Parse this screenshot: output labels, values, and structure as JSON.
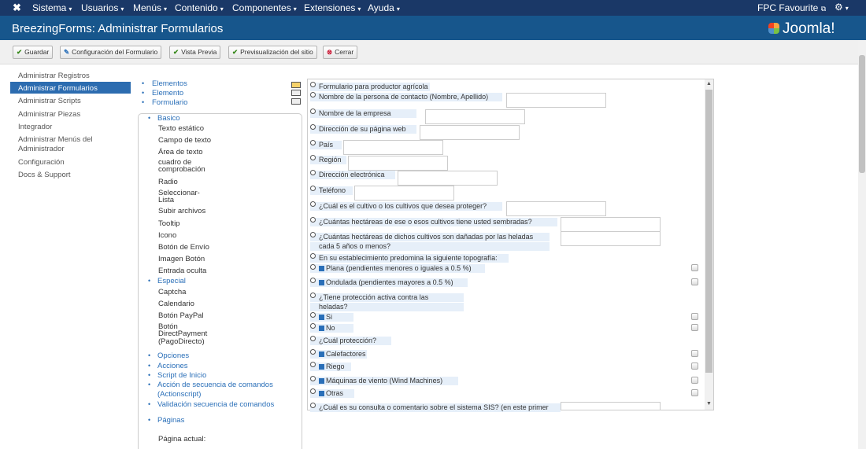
{
  "topnav": {
    "menu": [
      "Sistema",
      "Usuarios",
      "Menús",
      "Contenido",
      "Componentes",
      "Extensiones",
      "Ayuda"
    ],
    "user": "FPC Favourite",
    "user_icon": "external-link-icon",
    "settings_icon": "gear-icon"
  },
  "header": {
    "title": "BreezingForms: Administrar Formularios",
    "logo": "Joomla!"
  },
  "toolbar": {
    "buttons": [
      {
        "label": "Guardar",
        "icon": "✔"
      },
      {
        "label": "Configuración del Formulario",
        "icon": "✎"
      },
      {
        "label": "Vista Previa",
        "icon": "✔"
      },
      {
        "label": "Previsualización del sitio",
        "icon": "✔"
      },
      {
        "label": "Cerrar",
        "icon": "⊗"
      }
    ],
    "colors": {
      "check": "#3a8a1e",
      "edit": "#2a6fb8",
      "close": "#c8102e"
    }
  },
  "sidebar": {
    "items": [
      "Administrar Registros",
      "Administrar Formularios",
      "Administrar Scripts",
      "Administrar Piezas",
      "Integrador",
      "Administrar Menús del",
      "Administrador",
      "Configuración",
      "Docs & Support"
    ]
  },
  "tree": {
    "top": [
      "Elementos",
      "Elemento",
      "Formulario"
    ],
    "basico": "Basico",
    "basico_items": [
      "Texto estático",
      "Campo de texto",
      "Área de texto",
      "cuadro de",
      "comprobación",
      "Radio",
      "Seleccionar-",
      "Lista",
      "Subir archivos",
      "Tooltip",
      "Icono",
      "Botón de Envío",
      "Imagen Botón",
      "Entrada oculta"
    ],
    "especial": "Especial",
    "especial_items": [
      "Captcha",
      "Calendario",
      "Botón PayPal",
      "Botón",
      "DirectPayment",
      "(PagoDirecto)"
    ],
    "links": [
      "Opciones",
      "Acciones",
      "Script de Inicio",
      "Acción de secuencia de comandos",
      "(Actionscript)",
      "Validación secuencia de comandos"
    ],
    "paginas": "Páginas",
    "pagina_actual": "Página actual:"
  },
  "form": {
    "labels": [
      "Formulario para productor agrícola",
      "Nombre de la persona de contacto (Nombre, Apellido)",
      "Nombre de la empresa",
      "Dirección de su página web",
      "País",
      "Región",
      "Dirección electrónica",
      "Teléfono",
      "¿Cuál es el cultivo o los cultivos que desea proteger?",
      "¿Cuántas hectáreas de ese o esos cultivos tiene usted sembradas?",
      "¿Cuántas hectáreas de dichos cultivos son dañadas por las heladas",
      "cada 5 años o menos?",
      "En su establecimiento predomina la siguiente topografía:",
      "Plana (pendientes menores o iguales a 0.5 %)",
      "Ondulada (pendientes mayores a 0.5 %)",
      "¿Tiene protección activa contra las",
      "heladas?",
      "Si",
      "No",
      "¿Cuál protección?",
      "Calefactores",
      "Riego",
      "Máquinas de viento (Wind Machines)",
      "Otras",
      "¿Cuál es su consulta o comentario sobre el sistema SIS? (en este primer"
    ]
  }
}
